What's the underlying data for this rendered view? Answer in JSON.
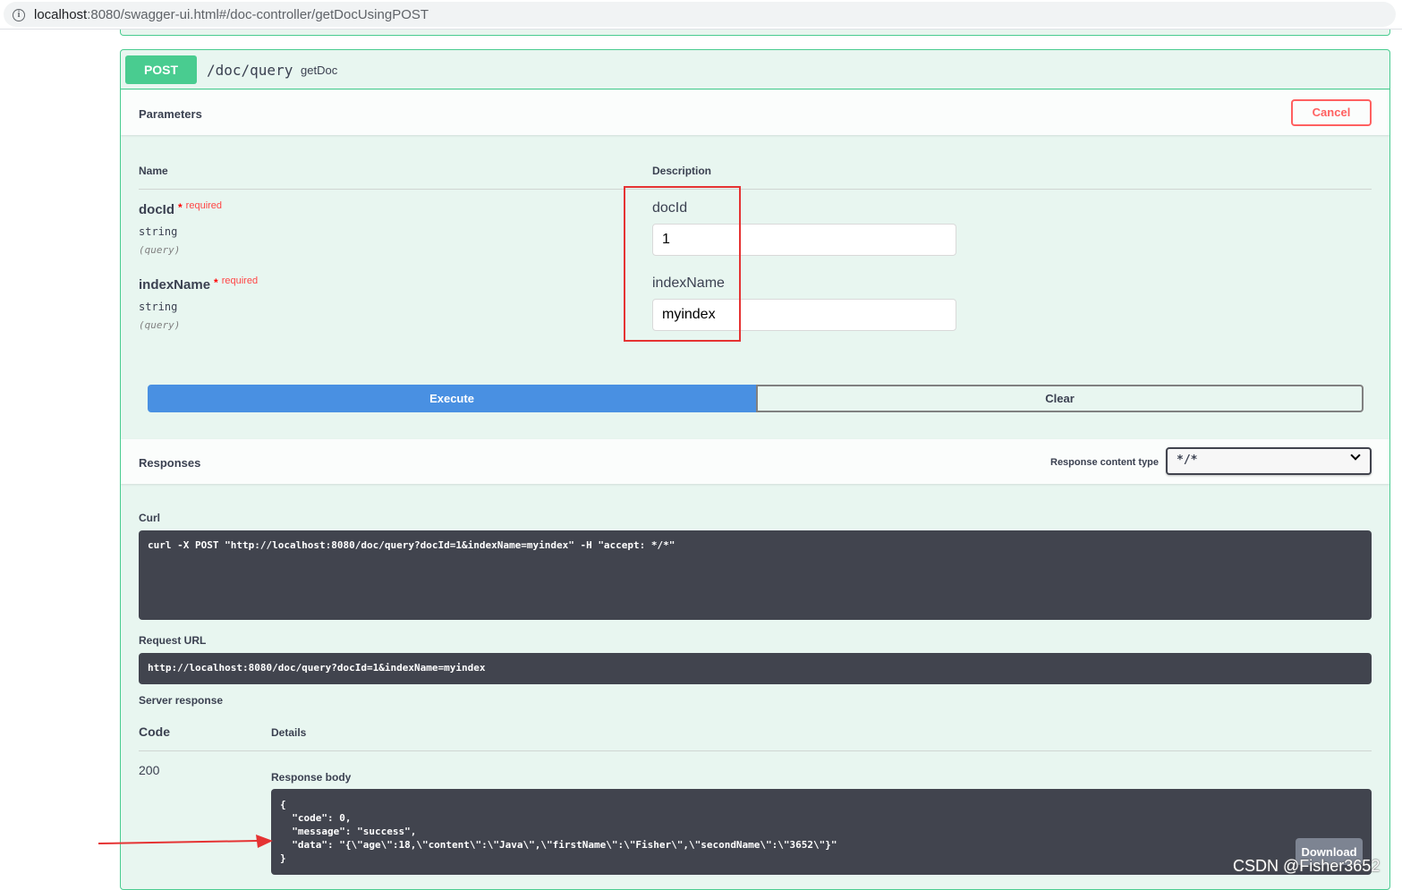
{
  "browser": {
    "url_host": "localhost",
    "url_rest": ":8080/swagger-ui.html#/doc-controller/getDocUsingPOST"
  },
  "operation": {
    "method": "POST",
    "path": "/doc/query",
    "summary": "getDoc"
  },
  "parameters": {
    "title": "Parameters",
    "cancel_label": "Cancel",
    "col_name": "Name",
    "col_description": "Description",
    "items": [
      {
        "name": "docId",
        "star": "*",
        "required": "required",
        "type": "string",
        "in": "(query)",
        "label": "docId",
        "value": "1"
      },
      {
        "name": "indexName",
        "star": "*",
        "required": "required",
        "type": "string",
        "in": "(query)",
        "label": "indexName",
        "value": "myindex"
      }
    ]
  },
  "actions": {
    "execute_label": "Execute",
    "clear_label": "Clear"
  },
  "responses": {
    "title": "Responses",
    "content_type_label": "Response content type",
    "content_type_value": "*/*",
    "curl_label": "Curl",
    "curl": "curl -X POST \"http://localhost:8080/doc/query?docId=1&indexName=myindex\" -H \"accept: */*\"",
    "request_url_label": "Request URL",
    "request_url": "http://localhost:8080/doc/query?docId=1&indexName=myindex",
    "server_response_label": "Server response",
    "code_header": "Code",
    "details_header": "Details",
    "status_code": "200",
    "body_label": "Response body",
    "body": "{\n  \"code\": 0,\n  \"message\": \"success\",\n  \"data\": \"{\\\"age\\\":18,\\\"content\\\":\\\"Java\\\",\\\"firstName\\\":\\\"Fisher\\\",\\\"secondName\\\":\\\"3652\\\"}\"\n}",
    "download_label": "Download"
  },
  "watermark": "CSDN @Fisher3652",
  "colors": {
    "post": "#49cc90",
    "execute": "#4990e2",
    "cancel": "#ff6060",
    "annotation": "#e53333"
  }
}
